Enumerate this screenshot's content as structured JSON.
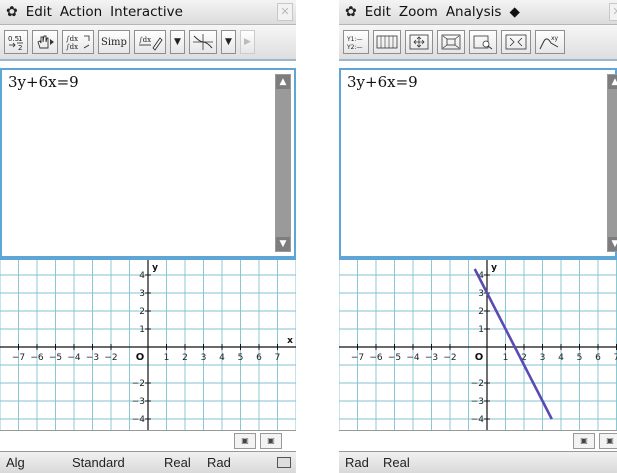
{
  "left": {
    "menu": {
      "items": [
        "Edit",
        "Action",
        "Interactive"
      ]
    },
    "toolbar": {
      "buttons": [
        "0.5 ⇆ 1/2",
        "hand",
        "∫dx",
        "Simp",
        "∫dx ✎",
        "▾",
        "graph",
        "▾",
        "▸"
      ]
    },
    "input": {
      "expression": "3y+6x=9"
    },
    "status": {
      "items": [
        "Alg",
        "Standard",
        "Real",
        "Rad"
      ]
    }
  },
  "right": {
    "menu": {
      "items": [
        "Edit",
        "Zoom",
        "Analysis",
        "◆"
      ]
    },
    "toolbar": {
      "buttons": [
        "Y1:— Y2:—",
        "table",
        "zoom-box",
        "zoom-in",
        "zoom-out",
        "auto",
        "trace"
      ]
    },
    "input": {
      "expression": "3y+6x=9"
    },
    "status": {
      "items": [
        "Rad",
        "Real"
      ]
    }
  },
  "graph": {
    "x_ticks": [
      "-7",
      "-6",
      "-5",
      "-4",
      "-3",
      "-2",
      "1",
      "2",
      "3",
      "4",
      "5",
      "6",
      "7"
    ],
    "y_ticks": [
      "4",
      "3",
      "2",
      "1",
      "-2",
      "-3",
      "-4"
    ],
    "origin_label": "O",
    "x_axis_label": "x",
    "y_axis_label": "y",
    "grid_color": "#7fc3cf",
    "line_color": "#5a4bb3"
  },
  "chart_data": {
    "type": "line",
    "title": "",
    "xlabel": "x",
    "ylabel": "y",
    "xlim": [
      -7.7,
      7.7
    ],
    "ylim": [
      -4.7,
      4.7
    ],
    "series": [
      {
        "x": [
          -0.5,
          3.5
        ],
        "y": [
          4,
          -4
        ]
      }
    ]
  }
}
